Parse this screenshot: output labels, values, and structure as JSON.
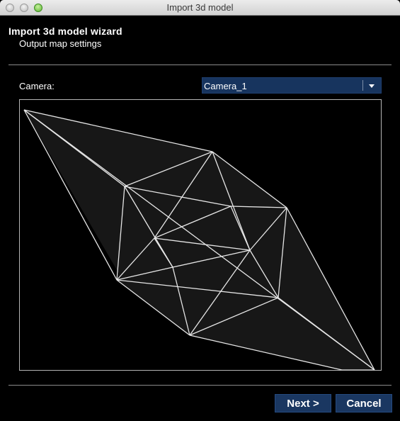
{
  "window": {
    "title": "Import 3d model"
  },
  "wizard": {
    "title": "Import 3d model wizard",
    "subtitle": "Output map settings"
  },
  "camera": {
    "label": "Camera:",
    "selected": "Camera_1"
  },
  "buttons": {
    "next_label": "Next >",
    "cancel_label": "Cancel"
  },
  "colors": {
    "background": "#000000",
    "accent_button": "#1a3761",
    "mesh_fill": "#171717",
    "mesh_edge": "#e6e6e6"
  },
  "icons": {
    "dropdown": "chevron-down-icon",
    "close": "close-icon",
    "minimize": "minimize-icon",
    "zoom": "zoom-icon"
  }
}
